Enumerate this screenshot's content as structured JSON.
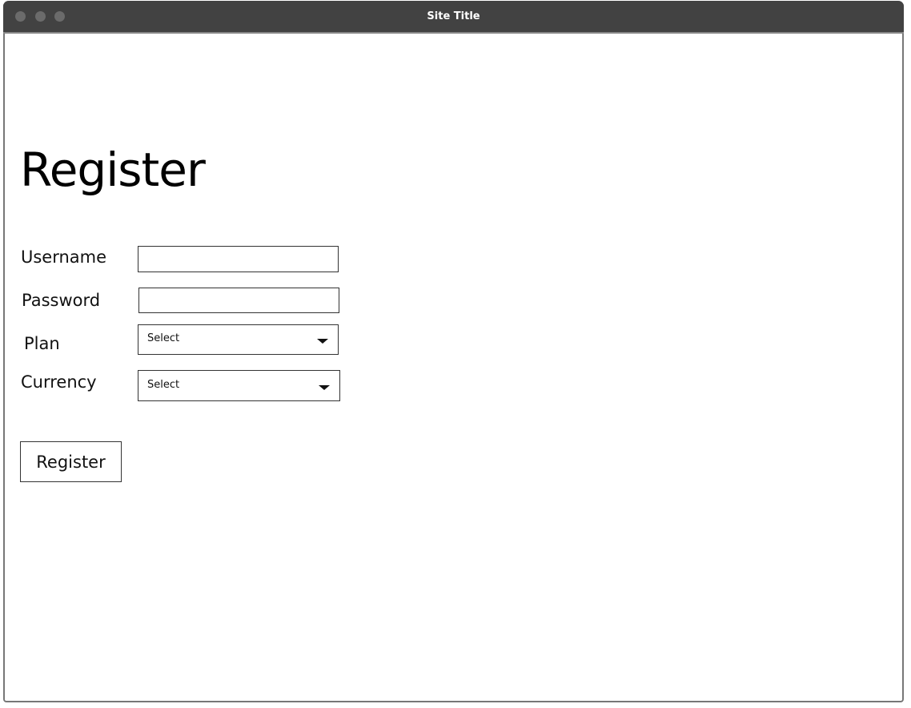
{
  "window": {
    "title": "Site Title"
  },
  "page": {
    "heading": "Register"
  },
  "form": {
    "username": {
      "label": "Username",
      "value": ""
    },
    "password": {
      "label": "Password",
      "value": ""
    },
    "plan": {
      "label": "Plan",
      "selected": "Select"
    },
    "currency": {
      "label": "Currency",
      "selected": "Select"
    },
    "submit_label": "Register"
  }
}
